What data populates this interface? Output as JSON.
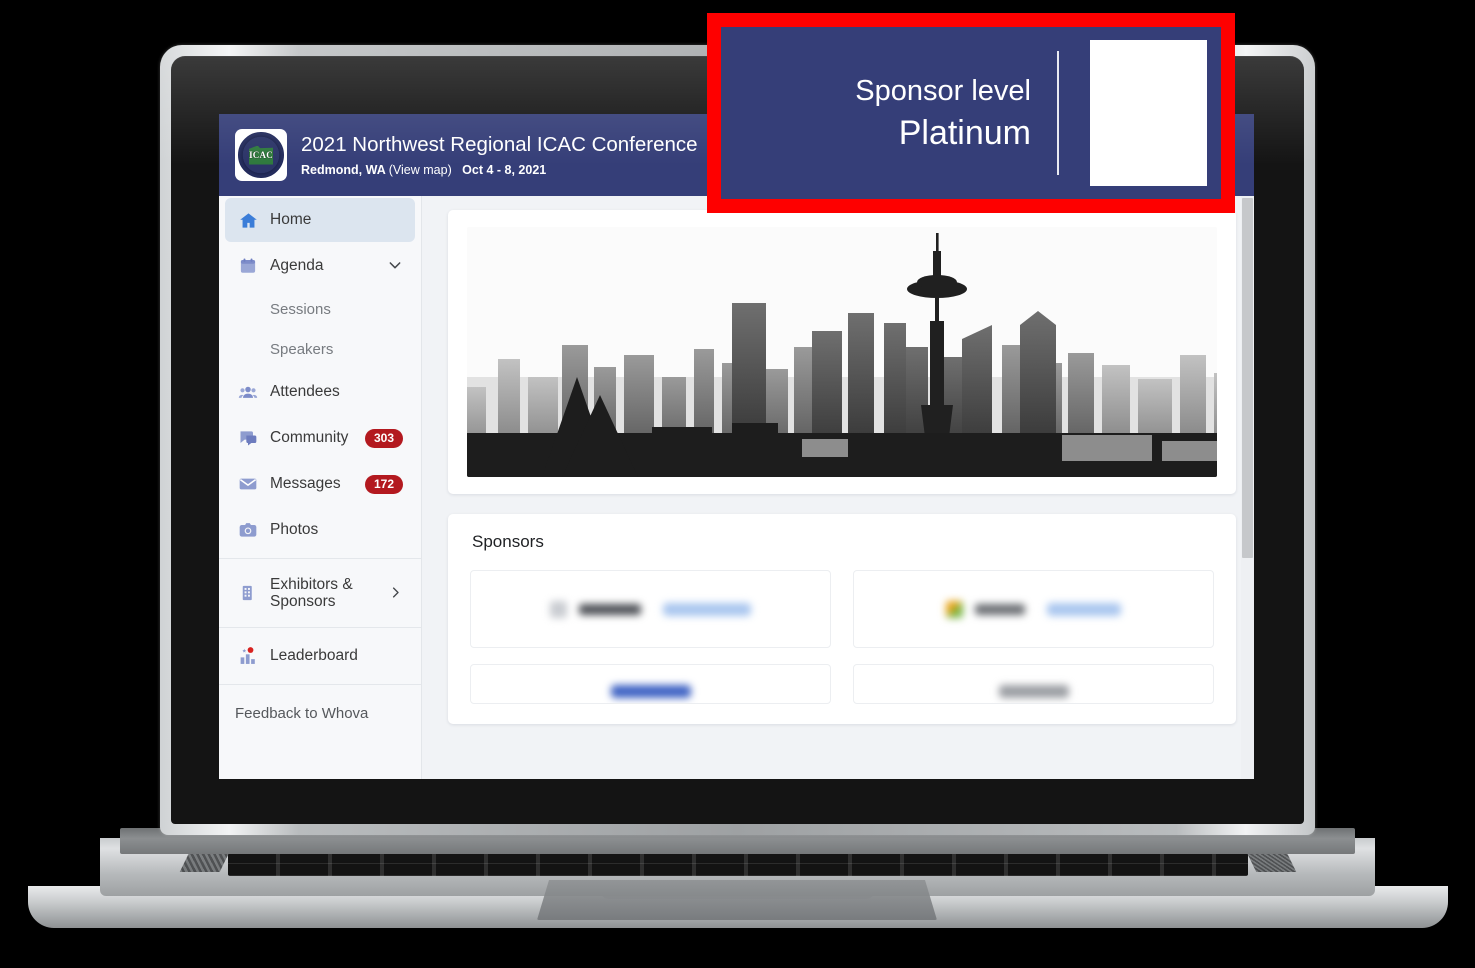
{
  "callout": {
    "line1": "Sponsor level",
    "line2": "Platinum",
    "border_color": "#fe0000",
    "panel_color": "#353e78"
  },
  "header": {
    "title": "2021 Northwest Regional ICAC Conference",
    "location": "Redmond, WA",
    "view_map": "(View map)",
    "dates": "Oct 4 - 8, 2021",
    "logo_text": "ICAC",
    "bg_color": "#353e78"
  },
  "sidebar": {
    "items": [
      {
        "label": "Home",
        "icon": "home-icon",
        "active": true
      },
      {
        "label": "Agenda",
        "icon": "calendar-icon",
        "chevron": "∨"
      },
      {
        "label": "Sessions",
        "icon": "",
        "sub": true
      },
      {
        "label": "Speakers",
        "icon": "",
        "sub": true
      },
      {
        "label": "Attendees",
        "icon": "people-icon"
      },
      {
        "label": "Community",
        "icon": "chat-icon",
        "badge": "303"
      },
      {
        "label": "Messages",
        "icon": "envelope-icon",
        "badge": "172"
      },
      {
        "label": "Photos",
        "icon": "camera-icon"
      },
      {
        "label": "Exhibitors & Sponsors",
        "icon": "building-icon",
        "chevron": "›"
      },
      {
        "label": "Leaderboard",
        "icon": "bar-chart-icon",
        "dot": true
      }
    ],
    "footer_link": "Feedback to Whova",
    "badge_color": "#b3191f",
    "active_bg": "#dce5ef"
  },
  "content": {
    "hero_alt": "Seattle skyline black and white photo",
    "sponsors_heading": "Sponsors",
    "sponsor_cards": [
      {
        "name": "sponsor-card-1"
      },
      {
        "name": "sponsor-card-2"
      },
      {
        "name": "sponsor-card-3"
      },
      {
        "name": "sponsor-card-4"
      }
    ]
  }
}
